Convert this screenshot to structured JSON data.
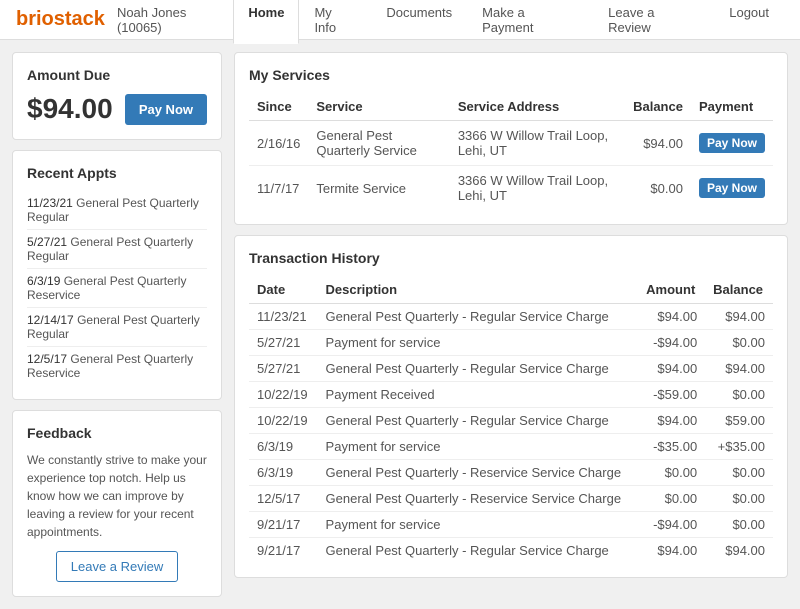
{
  "header": {
    "logo": "briostack",
    "user": "Noah Jones (10065)",
    "nav": [
      {
        "label": "Home",
        "active": true
      },
      {
        "label": "My Info",
        "active": false
      },
      {
        "label": "Documents",
        "active": false
      },
      {
        "label": "Make a Payment",
        "active": false
      },
      {
        "label": "Leave a Review",
        "active": false
      },
      {
        "label": "Logout",
        "active": false
      }
    ]
  },
  "amount_due": {
    "title": "Amount Due",
    "value": "$94.00",
    "pay_button": "Pay Now"
  },
  "recent_appts": {
    "title": "Recent Appts",
    "items": [
      {
        "date": "11/23/21",
        "description": "General Pest Quarterly Regular"
      },
      {
        "date": "5/27/21",
        "description": "General Pest Quarterly Regular"
      },
      {
        "date": "6/3/19",
        "description": "General Pest Quarterly Reservice"
      },
      {
        "date": "12/14/17",
        "description": "General Pest Quarterly Regular"
      },
      {
        "date": "12/5/17",
        "description": "General Pest Quarterly Reservice"
      }
    ]
  },
  "feedback": {
    "title": "Feedback",
    "text": "We constantly strive to make your experience top notch. Help us know how we can improve by leaving a review for your recent appointments.",
    "button": "Leave a Review"
  },
  "my_services": {
    "title": "My Services",
    "columns": [
      "Since",
      "Service",
      "Service Address",
      "Balance",
      "Payment"
    ],
    "rows": [
      {
        "since": "2/16/16",
        "service": "General Pest Quarterly Service",
        "address": "3366 W Willow Trail Loop, Lehi, UT",
        "balance": "$94.00",
        "payment_button": "Pay Now"
      },
      {
        "since": "11/7/17",
        "service": "Termite Service",
        "address": "3366 W Willow Trail Loop, Lehi, UT",
        "balance": "$0.00",
        "payment_button": "Pay Now"
      }
    ]
  },
  "transaction_history": {
    "title": "Transaction History",
    "columns": [
      "Date",
      "Description",
      "Amount",
      "Balance"
    ],
    "rows": [
      {
        "date": "11/23/21",
        "description": "General Pest Quarterly - Regular Service Charge",
        "amount": "$94.00",
        "balance": "$94.00",
        "positive": false
      },
      {
        "date": "5/27/21",
        "description": "Payment for service",
        "amount": "-$94.00",
        "balance": "$0.00",
        "positive": false
      },
      {
        "date": "5/27/21",
        "description": "General Pest Quarterly - Regular Service Charge",
        "amount": "$94.00",
        "balance": "$94.00",
        "positive": false
      },
      {
        "date": "10/22/19",
        "description": "Payment Received",
        "amount": "-$59.00",
        "balance": "$0.00",
        "positive": false
      },
      {
        "date": "10/22/19",
        "description": "General Pest Quarterly - Regular Service Charge",
        "amount": "$94.00",
        "balance": "$59.00",
        "positive": false
      },
      {
        "date": "6/3/19",
        "description": "Payment for service",
        "amount": "-$35.00",
        "balance": "+$35.00",
        "positive": true
      },
      {
        "date": "6/3/19",
        "description": "General Pest Quarterly - Reservice Service Charge",
        "amount": "$0.00",
        "balance": "$0.00",
        "positive": false
      },
      {
        "date": "12/5/17",
        "description": "General Pest Quarterly - Reservice Service Charge",
        "amount": "$0.00",
        "balance": "$0.00",
        "positive": false
      },
      {
        "date": "9/21/17",
        "description": "Payment for service",
        "amount": "-$94.00",
        "balance": "$0.00",
        "positive": false
      },
      {
        "date": "9/21/17",
        "description": "General Pest Quarterly - Regular Service Charge",
        "amount": "$94.00",
        "balance": "$94.00",
        "positive": false
      }
    ]
  }
}
